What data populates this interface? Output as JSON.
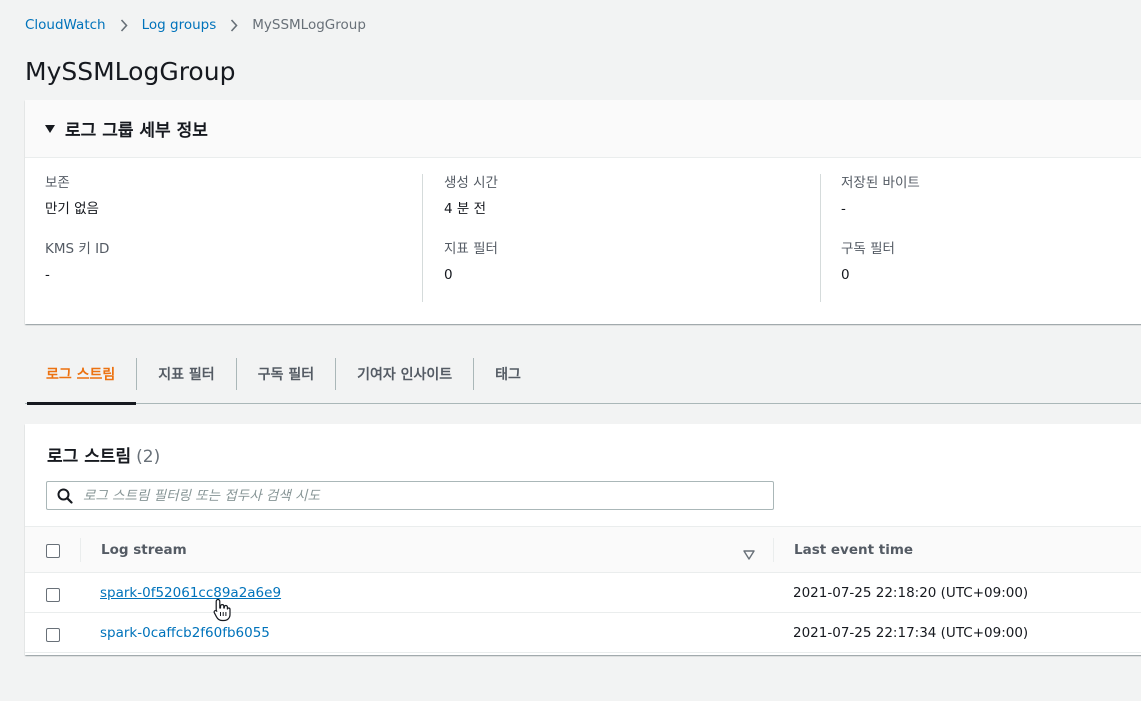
{
  "breadcrumb": {
    "items": [
      "CloudWatch",
      "Log groups"
    ],
    "current": "MySSMLogGroup"
  },
  "page_title": "MySSMLogGroup",
  "details": {
    "title": "로그 그룹 세부 정보",
    "fields": {
      "retention": {
        "label": "보존",
        "value": "만기 없음"
      },
      "kms": {
        "label": "KMS 키 ID",
        "value": "-"
      },
      "created": {
        "label": "생성 시간",
        "value": "4 분 전"
      },
      "metric_filters": {
        "label": "지표 필터",
        "value": "0"
      },
      "stored_bytes": {
        "label": "저장된 바이트",
        "value": "-"
      },
      "subscription_filters": {
        "label": "구독 필터",
        "value": "0"
      }
    }
  },
  "tabs": [
    {
      "label": "로그 스트림",
      "active": true
    },
    {
      "label": "지표 필터"
    },
    {
      "label": "구독 필터"
    },
    {
      "label": "기여자 인사이트"
    },
    {
      "label": "태그"
    }
  ],
  "streams": {
    "title": "로그 스트림",
    "count": "(2)",
    "search_placeholder": "로그 스트림 필터링 또는 접두사 검색 시도",
    "columns": {
      "name": "Log stream",
      "time": "Last event time"
    },
    "rows": [
      {
        "name": "spark-0f52061cc89a2a6e9",
        "time": "2021-07-25 22:18:20 (UTC+09:00)"
      },
      {
        "name": "spark-0caffcb2f60fb6055",
        "time": "2021-07-25 22:17:34 (UTC+09:00)"
      }
    ]
  },
  "colors": {
    "link": "#0073bb",
    "active_tab": "#ec7211",
    "text": "#16191f",
    "muted": "#545b64"
  }
}
